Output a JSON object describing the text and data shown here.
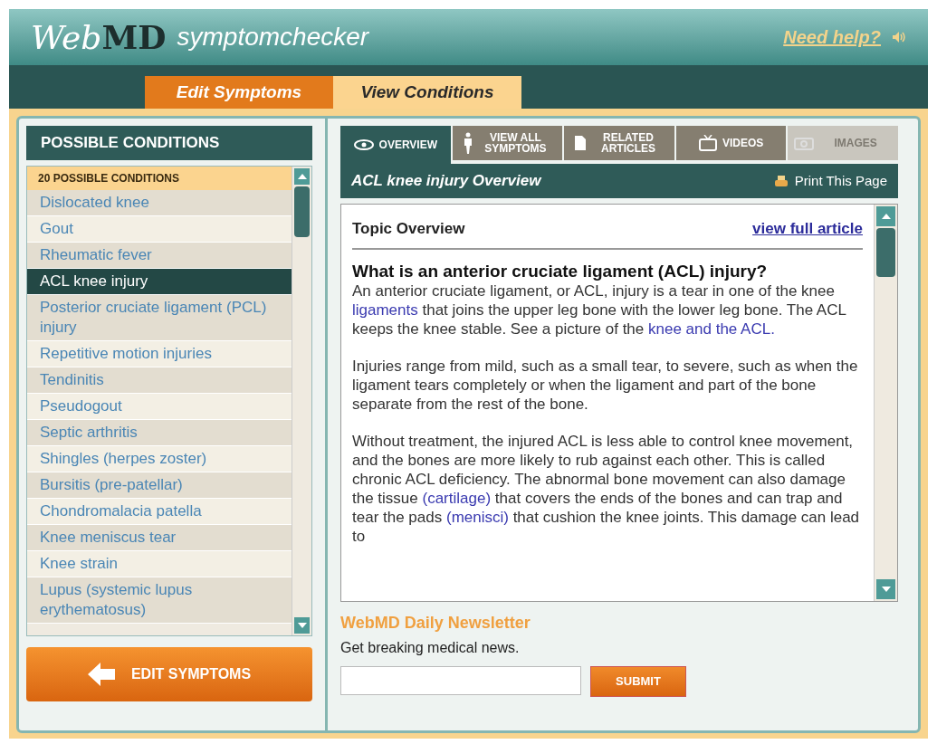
{
  "header": {
    "logo_web": "Web",
    "logo_md": "MD",
    "app_name": "symptomchecker",
    "help_link": "Need help?"
  },
  "main_tabs": [
    {
      "label": "Edit Symptoms",
      "selected": false
    },
    {
      "label": "View Conditions",
      "selected": true
    }
  ],
  "conditions_panel": {
    "title": "POSSIBLE CONDITIONS",
    "count_label": "20 POSSIBLE CONDITIONS",
    "items": [
      {
        "label": "Dislocated knee",
        "selected": false
      },
      {
        "label": "Gout",
        "selected": false
      },
      {
        "label": "Rheumatic fever",
        "selected": false
      },
      {
        "label": "ACL knee injury",
        "selected": true
      },
      {
        "label": "Posterior cruciate ligament (PCL) injury",
        "selected": false
      },
      {
        "label": "Repetitive motion injuries",
        "selected": false
      },
      {
        "label": "Tendinitis",
        "selected": false
      },
      {
        "label": "Pseudogout",
        "selected": false
      },
      {
        "label": "Septic arthritis",
        "selected": false
      },
      {
        "label": "Shingles (herpes zoster)",
        "selected": false
      },
      {
        "label": "Bursitis (pre-patellar)",
        "selected": false
      },
      {
        "label": "Chondromalacia patella",
        "selected": false
      },
      {
        "label": "Knee meniscus tear",
        "selected": false
      },
      {
        "label": "Knee strain",
        "selected": false
      },
      {
        "label": "Lupus (systemic lupus erythematosus)",
        "selected": false
      }
    ],
    "back_button": "EDIT SYMPTOMS"
  },
  "content_tabs": [
    {
      "label": "OVERVIEW",
      "selected": true,
      "disabled": false
    },
    {
      "label": "VIEW ALL SYMPTOMS",
      "selected": false,
      "disabled": false
    },
    {
      "label": "RELATED ARTICLES",
      "selected": false,
      "disabled": false
    },
    {
      "label": "VIDEOS",
      "selected": false,
      "disabled": false
    },
    {
      "label": "IMAGES",
      "selected": false,
      "disabled": true
    }
  ],
  "article": {
    "title": "ACL knee injury Overview",
    "print_link": "Print This Page",
    "section": "Topic Overview",
    "full_link": "view full article",
    "heading": "What is an anterior cruciate ligament (ACL) injury?",
    "paragraphs": [
      [
        {
          "text": "An anterior cruciate ligament, or ACL, injury is a tear in one of the knee ",
          "link": false
        },
        {
          "text": "ligaments",
          "link": true
        },
        {
          "text": " that joins the upper leg bone with the lower leg bone. The ACL keeps the knee stable. See a picture of the ",
          "link": false
        },
        {
          "text": "knee and the ACL.",
          "link": true
        }
      ],
      [
        {
          "text": "Injuries range from mild, such as a small tear, to severe, such as when the ligament tears completely or when the ligament and part of the bone separate from the rest of the bone.",
          "link": false
        }
      ],
      [
        {
          "text": "Without treatment, the injured ACL is less able to control knee movement, and the bones are more likely to rub against each other. This is called chronic ACL deficiency. The abnormal bone movement can also damage the tissue ",
          "link": false
        },
        {
          "text": "(cartilage)",
          "link": true
        },
        {
          "text": " that covers the ends of the bones and can trap and tear the pads ",
          "link": false
        },
        {
          "text": "(menisci)",
          "link": true
        },
        {
          "text": " that cushion the knee joints. This damage can lead to",
          "link": false
        }
      ]
    ]
  },
  "newsletter": {
    "title": "WebMD Daily Newsletter",
    "text": "Get breaking medical news.",
    "submit": "SUBMIT"
  }
}
